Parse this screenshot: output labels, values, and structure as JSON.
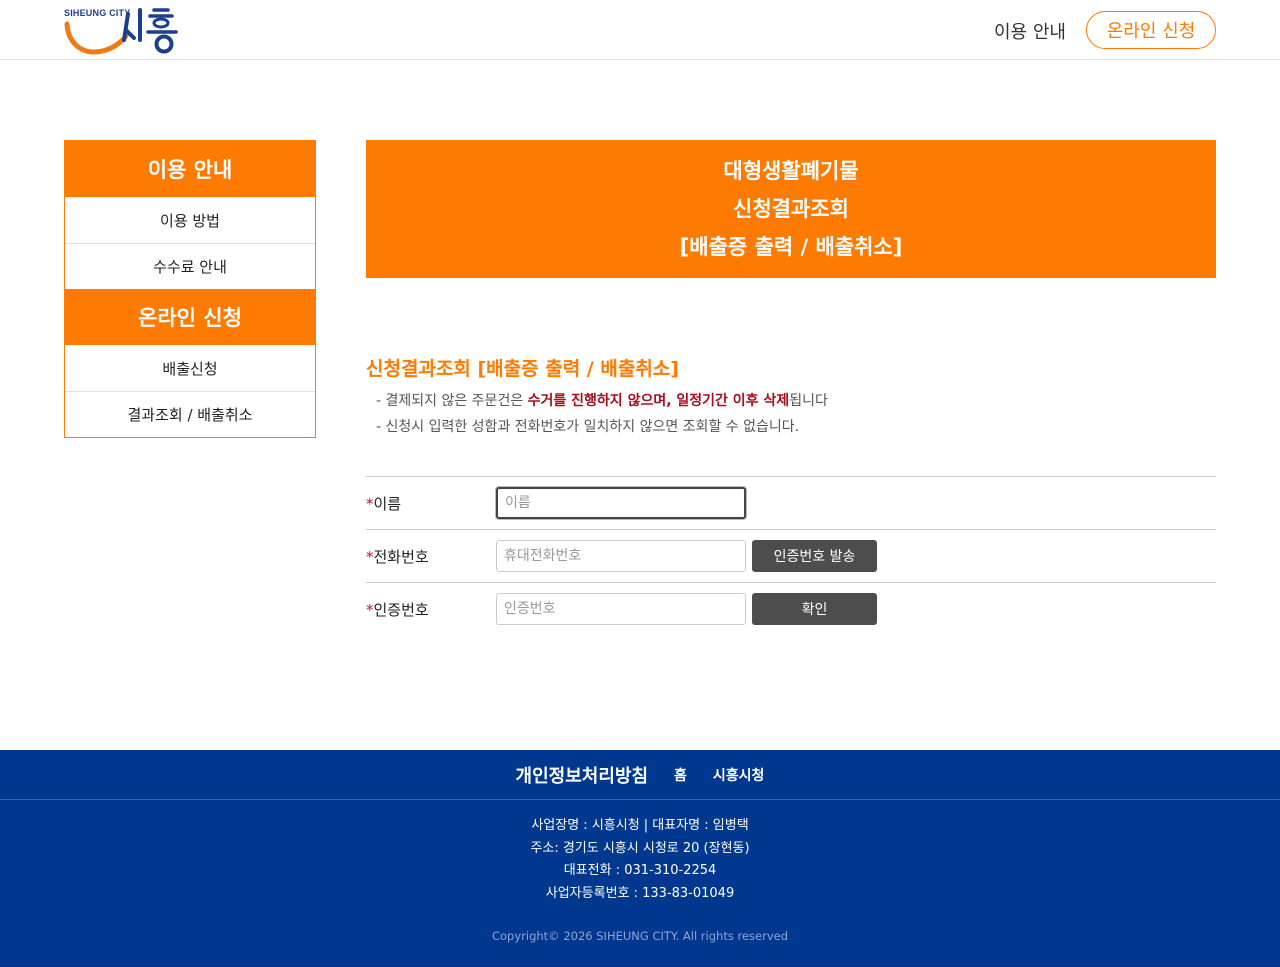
{
  "header": {
    "logo_text": "SIHEUNG CITY",
    "logo_mark": "시흥",
    "nav_guide": "이용 안내",
    "nav_apply": "온라인 신청"
  },
  "sidebar": {
    "group1_title": "이용 안내",
    "group1_items": [
      "이용 방법",
      "수수료 안내"
    ],
    "group2_title": "온라인 신청",
    "group2_items": [
      "배출신청",
      "결과조회 / 배출취소"
    ]
  },
  "banner": {
    "line1": "대형생활폐기물",
    "line2": "신청결과조회",
    "line3": "[배출증 출력 / 배출취소]"
  },
  "section": {
    "title": "신청결과조회 [배출증 출력 / 배출취소]",
    "note1_prefix": "- 결제되지 않은 주문건은 ",
    "note1_emphasis": "수거를 진행하지 않으며, 일정기간 이후 삭제",
    "note1_suffix": "됩니다",
    "note2": "- 신청시 입력한 성함과 전화번호가 일치하지 않으면 조회할 수 없습니다."
  },
  "form": {
    "required_mark": "*",
    "name_label": "이름",
    "name_placeholder": "이름",
    "name_value": "",
    "phone_label": "전화번호",
    "phone_placeholder": "휴대전화번호",
    "phone_value": "",
    "send_code_button": "인증번호 발송",
    "code_label": "인증번호",
    "code_placeholder": "인증번호",
    "code_value": "",
    "confirm_button": "확인"
  },
  "footer": {
    "privacy_link": "개인정보처리방침",
    "home_link": "홈",
    "city_link": "시흥시청",
    "business_line": "사업장명 : 시흥시청 | 대표자명 : 임병택",
    "address_line": "주소: 경기도 시흥시 시청로 20 (장현동)",
    "phone_line": "대표전화 : 031-310-2254",
    "registration_line": "사업자등록번호 : 133-83-01049",
    "copyright": "Copyright© 2026 SIHEUNG CITY. All rights reserved"
  },
  "colors": {
    "accent": "#ff7a00",
    "footer_bg": "#00388f",
    "button_bg": "#4d4d4d",
    "emphasis_red": "#a80d1d"
  }
}
